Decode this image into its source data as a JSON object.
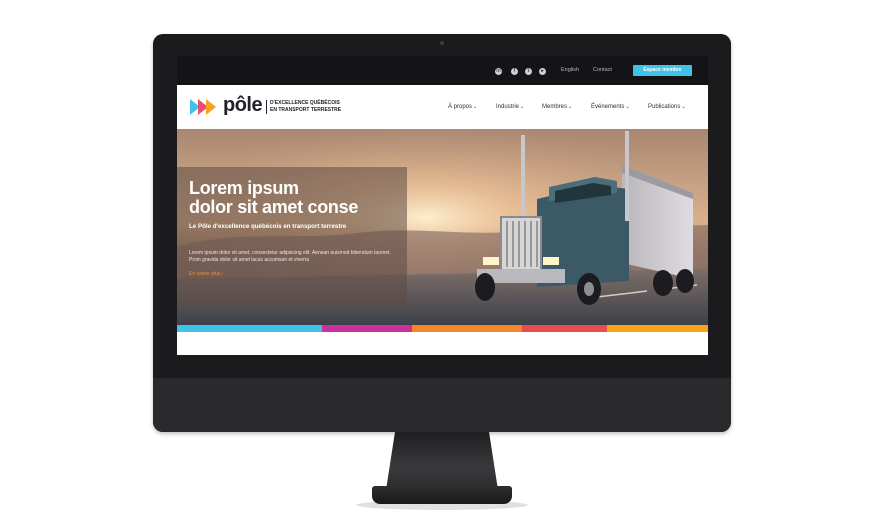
{
  "header": {
    "social_icons": [
      "linkedin-icon",
      "facebook-icon",
      "twitter-icon",
      "youtube-icon"
    ],
    "language": "English",
    "contact": "Contact",
    "member_space": "Espace membre"
  },
  "logo": {
    "word": "pôle",
    "tagline_line1": "D'EXCELLENCE QUÉBÉCOIS",
    "tagline_line2": "EN TRANSPORT TERRESTRE",
    "colors": [
      "#3fc3ea",
      "#e94e77",
      "#f7a21b"
    ]
  },
  "nav": {
    "items": [
      {
        "label": "À propos"
      },
      {
        "label": "Industrie"
      },
      {
        "label": "Membres"
      },
      {
        "label": "Événements"
      },
      {
        "label": "Publications"
      }
    ]
  },
  "hero": {
    "title_line1": "Lorem ipsum",
    "title_line2": "dolor sit amet conse",
    "subtitle": "Le Pôle d'excellence québécois en transport terrestre",
    "body": "Lorem ipsum dolor sit amet, consectetur adipiscing elit. Aenean euismod bibendum laoreet. Proin gravida dolor sit amet lacus accumsan et viverra",
    "more_link": "En savoir plus ›"
  },
  "colors": {
    "accent_cyan": "#3fc3ea",
    "accent_magenta": "#c8329a",
    "accent_orange": "#f3882b",
    "accent_red": "#e94c4c",
    "accent_amber": "#f7a21b"
  }
}
